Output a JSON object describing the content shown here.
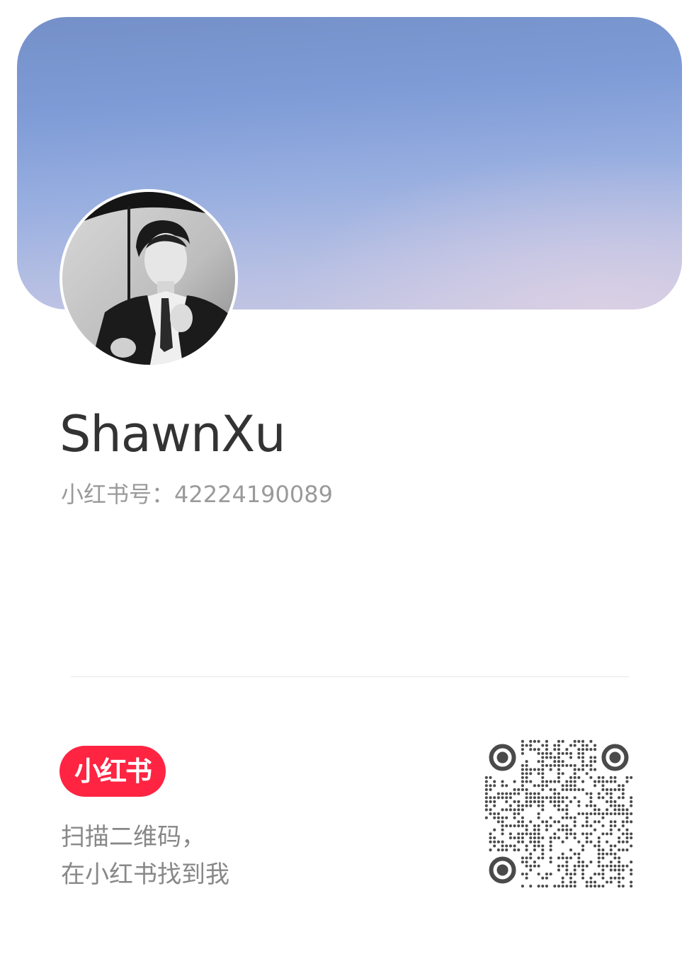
{
  "profile": {
    "username": "ShawnXu",
    "id_label": "小红书号：",
    "id_value": "42224190089"
  },
  "footer": {
    "logo_text": "小红书",
    "tagline_line1": "扫描二维码，",
    "tagline_line2": "在小红书找到我"
  },
  "colors": {
    "brand_red": "#ff2442",
    "banner_top": "#7590c8",
    "banner_bottom": "#c8c8e2",
    "text_primary": "#333333",
    "text_secondary": "#9a9a9a"
  },
  "icons": {
    "avatar": "profile-photo",
    "qr": "qr-code"
  }
}
